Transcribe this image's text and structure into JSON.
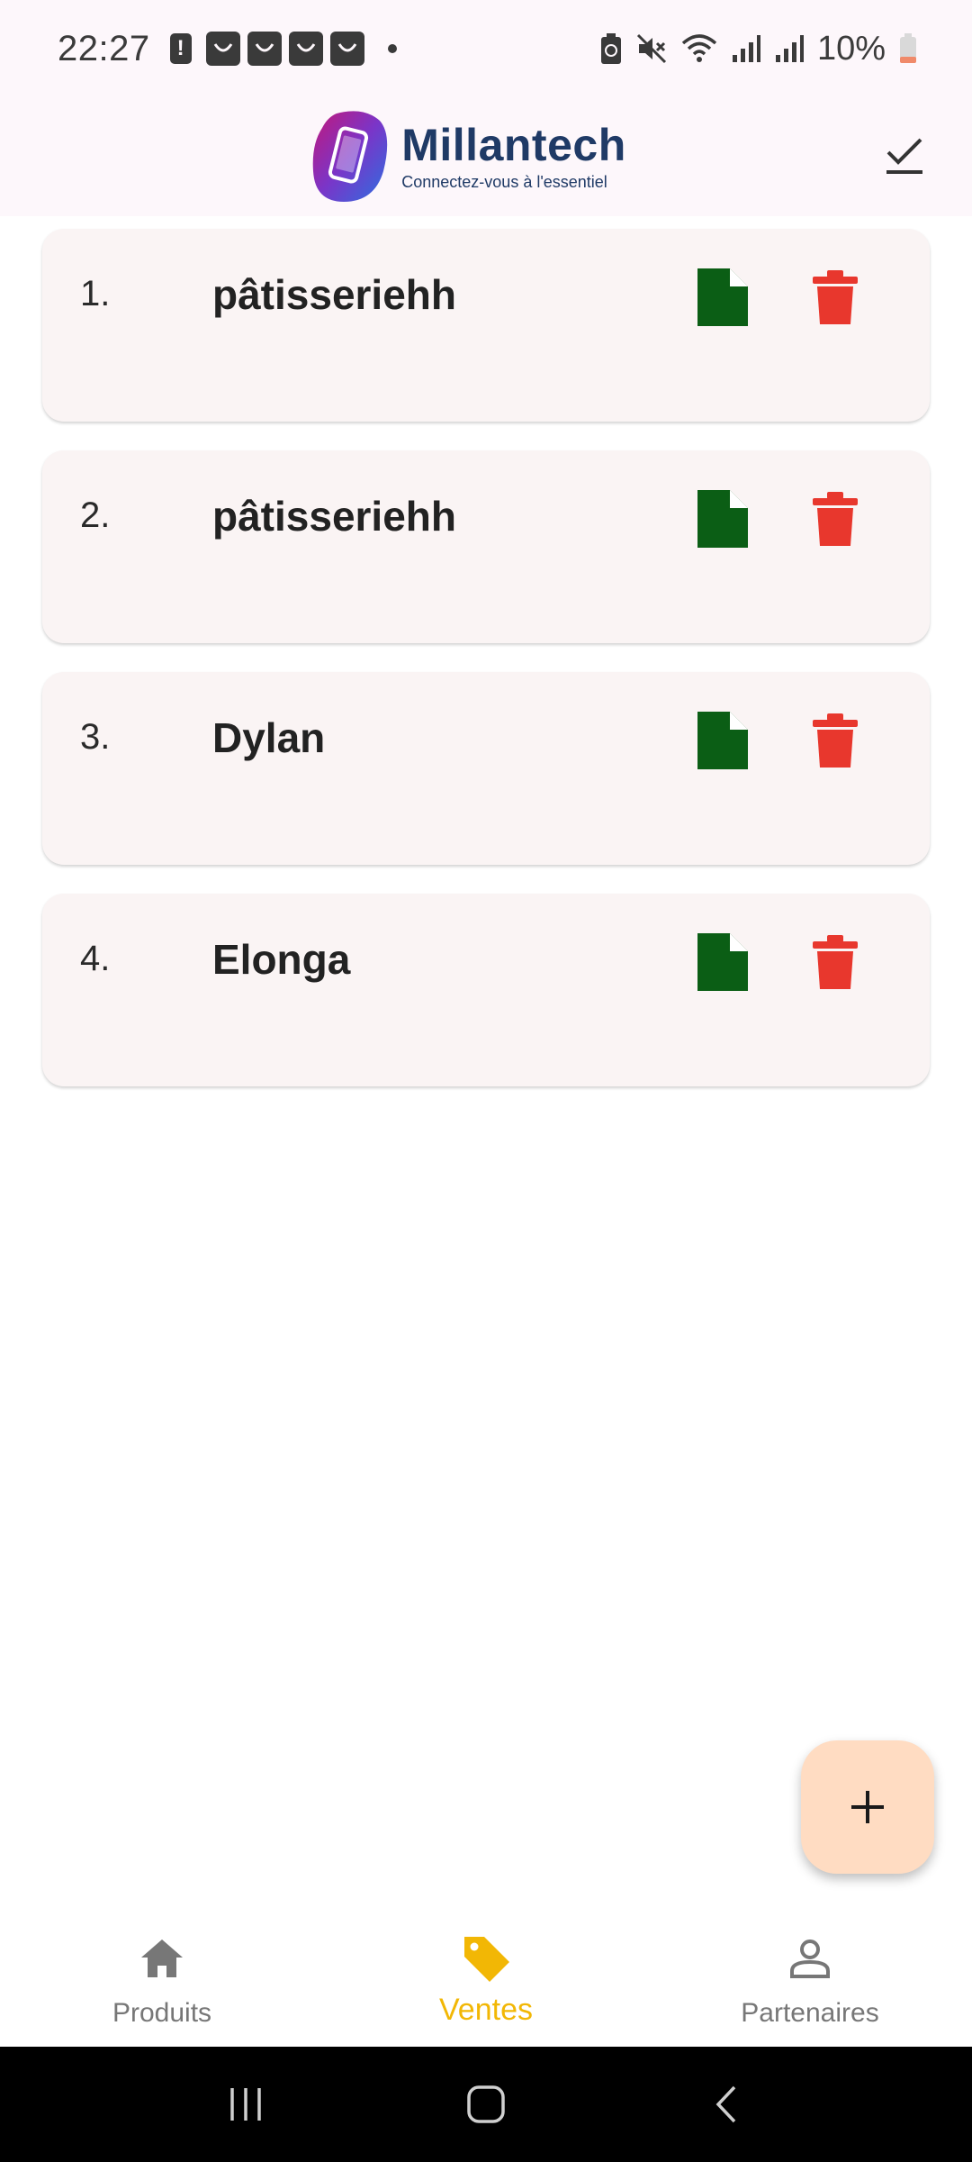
{
  "status_bar": {
    "time": "22:27",
    "battery": "10%"
  },
  "header": {
    "app_name": "Millantech",
    "tagline": "Connectez-vous à l'essentiel"
  },
  "items": [
    {
      "index": "1.",
      "name": "pâtisseriehh"
    },
    {
      "index": "2.",
      "name": "pâtisseriehh"
    },
    {
      "index": "3.",
      "name": "Dylan"
    },
    {
      "index": "4.",
      "name": "Elonga"
    }
  ],
  "fab": {
    "icon": "plus-icon"
  },
  "bottom_nav": {
    "items": [
      {
        "label": "Produits",
        "icon": "home-icon",
        "active": false
      },
      {
        "label": "Ventes",
        "icon": "tag-icon",
        "active": true
      },
      {
        "label": "Partenaires",
        "icon": "person-icon",
        "active": false
      }
    ]
  },
  "colors": {
    "header_bg": "#fdf7fb",
    "card_bg": "#faf4f4",
    "doc_icon": "#0b5e15",
    "delete_icon": "#e8372d",
    "fab_bg": "#ffdcc2",
    "active_nav": "#f2b705",
    "brand": "#1f3a66"
  }
}
